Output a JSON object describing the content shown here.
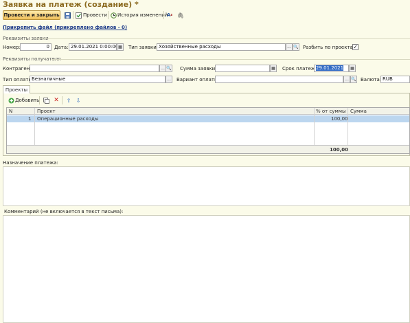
{
  "window": {
    "title": "Заявка на платеж (создание) *"
  },
  "toolbar": {
    "post_close_label": "Провести и закрыть",
    "post_label": "Провести",
    "history_label": "История изменений"
  },
  "attachment_link": "Прикрепить файл (прикреплено файлов - 0)",
  "request_section": {
    "title": "Реквизиты заявки",
    "number_label": "Номер:",
    "number_value": "0",
    "date_label": "Дата:",
    "date_value": "29.01.2021  0:00:00",
    "type_label": "Тип заявки:",
    "type_value": "Хозяйственные расходы",
    "split_label": "Разбить по проектам:",
    "split_checked": true
  },
  "recipient_section": {
    "title": "Реквизиты получателя",
    "counterparty_label": "Контрагент:",
    "counterparty_value": "",
    "amount_label": "Сумма заявки:",
    "amount_value": "",
    "deadline_label": "Срок платежа:",
    "deadline_value": "29.01.2021",
    "payment_type_label": "Тип оплаты:",
    "payment_type_value": "Безналичные",
    "payment_variant_label": "Вариант оплаты:",
    "payment_variant_value": "",
    "currency_label": "Валюта:",
    "currency_value": "RUB"
  },
  "tabs": [
    {
      "label": "Проекты"
    }
  ],
  "projects": {
    "add_label": "Добавить",
    "columns": {
      "n": "N",
      "project": "Проект",
      "percent": "% от суммы",
      "sum": "Сумма"
    },
    "rows": [
      {
        "n": "1",
        "project": "Операционные расходы",
        "percent": "100,00",
        "sum": ""
      }
    ],
    "total_percent": "100,00"
  },
  "purpose_label": "Назначение платежа:",
  "comment_label": "Комментарий (не включается в текст письма):",
  "colors": {
    "title": "#8b6a1f",
    "selected_row": "#bcd6ef",
    "background": "#fbfbe9"
  }
}
